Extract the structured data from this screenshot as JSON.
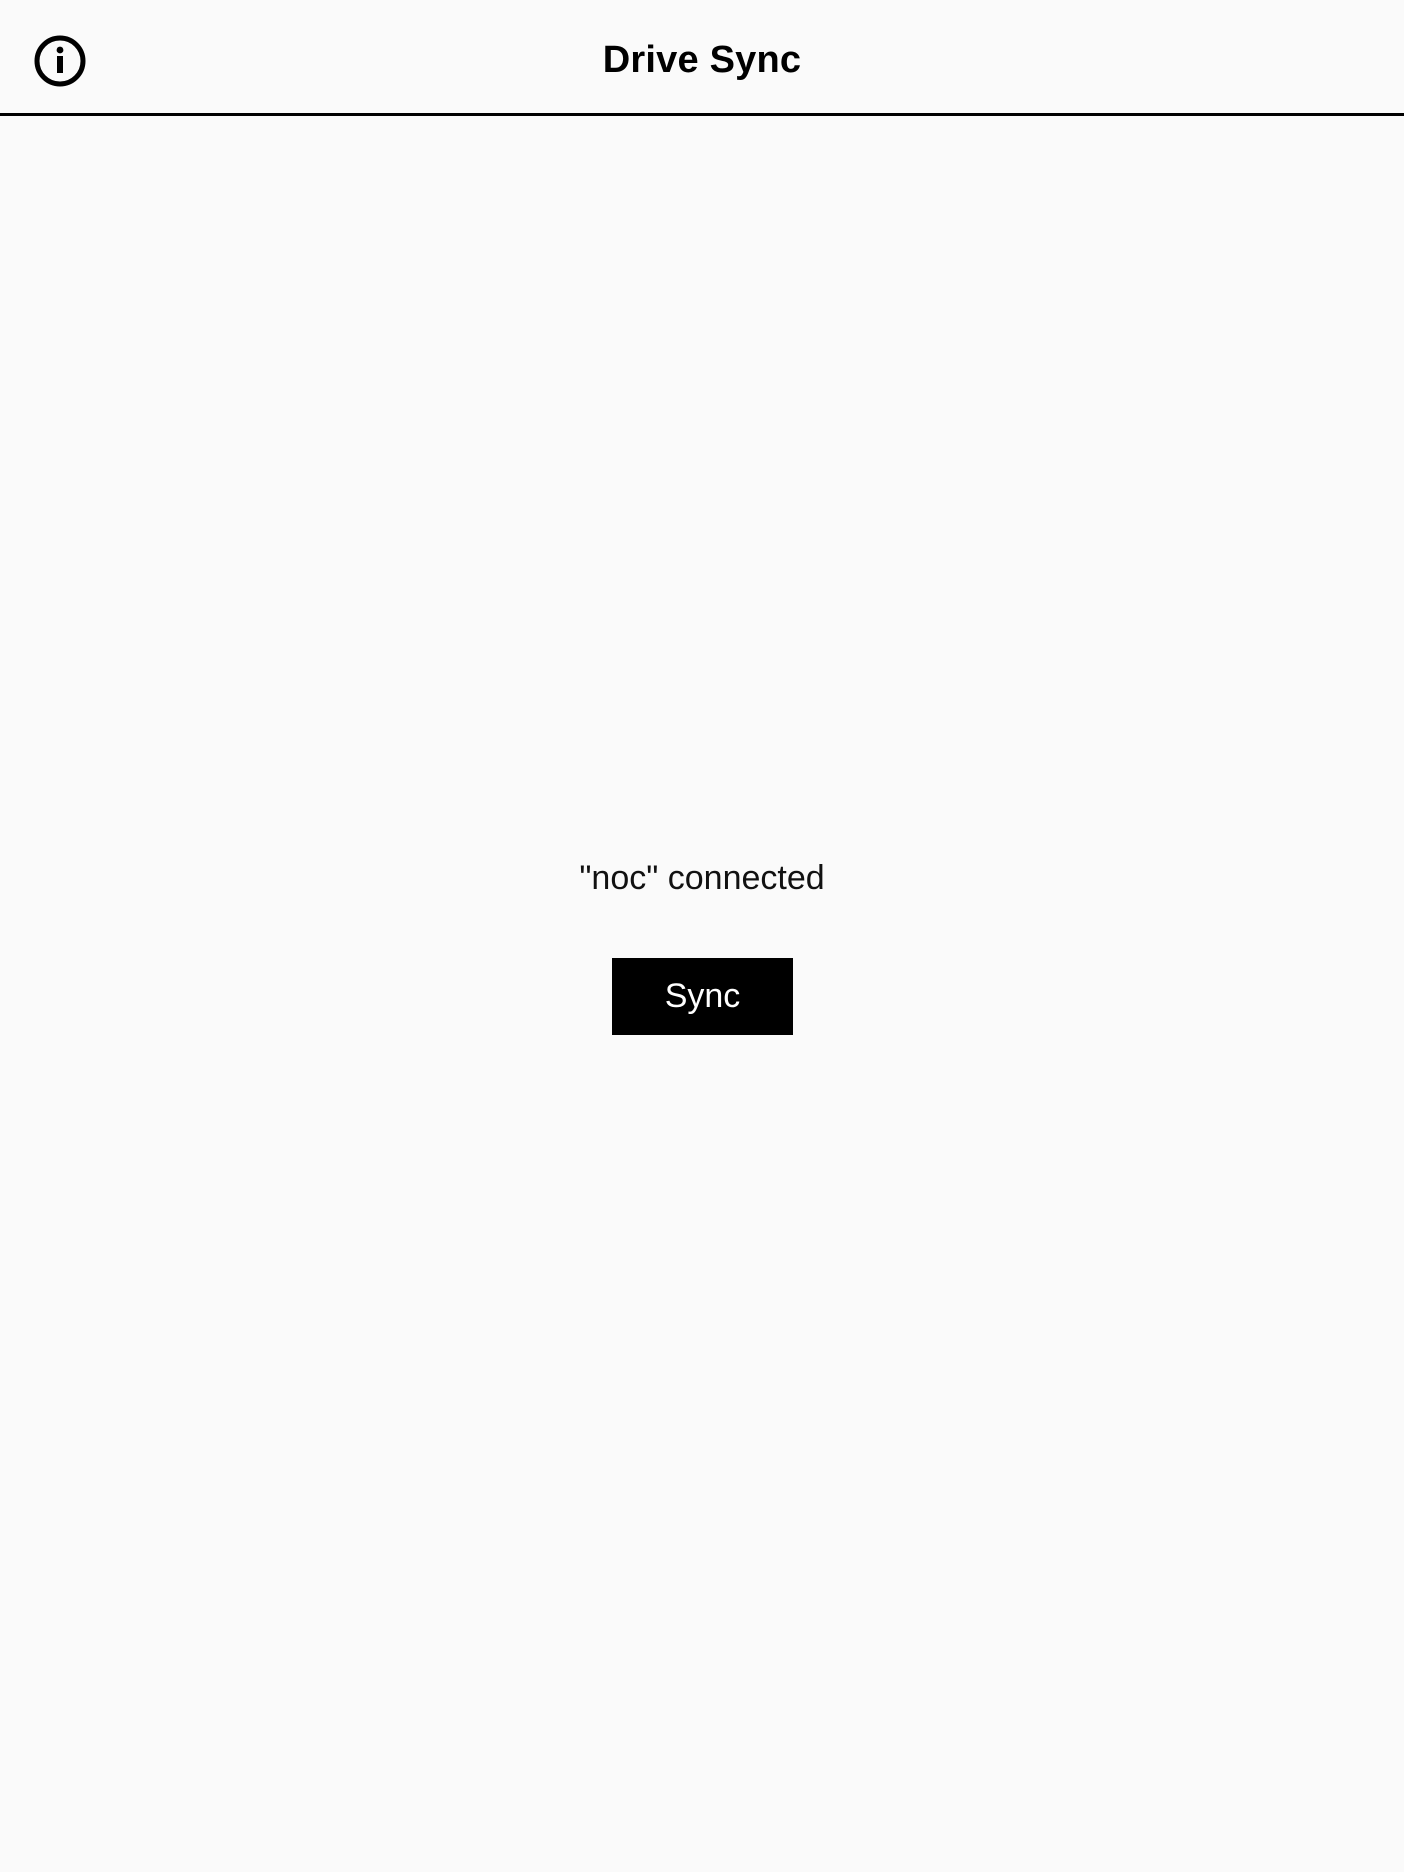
{
  "header": {
    "title": "Drive Sync",
    "info_icon": "info-circle-icon"
  },
  "main": {
    "status_text": "\"noc\" connected",
    "sync_label": "Sync"
  },
  "colors": {
    "background": "#fafafa",
    "foreground": "#000000",
    "button_background": "#000000",
    "button_text": "#ffffff"
  }
}
